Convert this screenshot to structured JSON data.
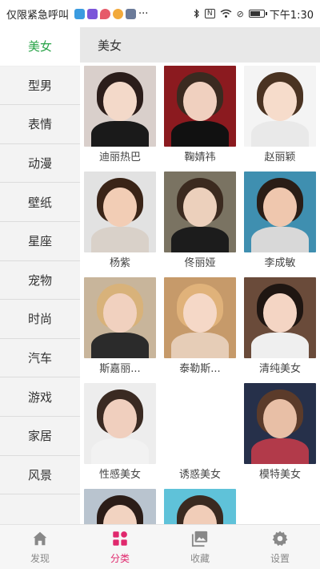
{
  "status_bar": {
    "carrier_text": "仅限紧急呼叫",
    "notification_icons": [
      "person-icon",
      "app-icon",
      "location-icon",
      "coin-icon",
      "image-icon"
    ],
    "more": "···",
    "time": "下午1:30",
    "battery_level": 0.8
  },
  "sidebar": {
    "items": [
      {
        "label": "美女",
        "active": true
      },
      {
        "label": "型男"
      },
      {
        "label": "表情"
      },
      {
        "label": "动漫"
      },
      {
        "label": "壁纸"
      },
      {
        "label": "星座"
      },
      {
        "label": "宠物"
      },
      {
        "label": "时尚"
      },
      {
        "label": "汽车"
      },
      {
        "label": "游戏"
      },
      {
        "label": "家居"
      },
      {
        "label": "风景"
      }
    ]
  },
  "content": {
    "header": "美女",
    "tiles": [
      {
        "label": "迪丽热巴",
        "colors": [
          "#d9cfcb",
          "#2b1d1a",
          "#f3d9c9",
          "#1a1a1a"
        ]
      },
      {
        "label": "鞠婧祎",
        "colors": [
          "#8b1a1f",
          "#3a2a20",
          "#f0d0bf",
          "#111111"
        ]
      },
      {
        "label": "赵丽颖",
        "colors": [
          "#f4f4f4",
          "#4a3322",
          "#f6dccb",
          "#e9e9e9"
        ]
      },
      {
        "label": "杨紫",
        "colors": [
          "#e2e2e2",
          "#3a2417",
          "#f2cdb5",
          "#d9d1c9"
        ]
      },
      {
        "label": "佟丽娅",
        "colors": [
          "#7a7362",
          "#3b2a1f",
          "#ecd0bc",
          "#1c1c1c"
        ]
      },
      {
        "label": "李成敏",
        "colors": [
          "#3f8fb0",
          "#2a1d16",
          "#efc7ae",
          "#d8d8d8"
        ]
      },
      {
        "label": "斯嘉丽...",
        "colors": [
          "#c8b59b",
          "#d8b27a",
          "#f1d1bf",
          "#2b2b2b"
        ]
      },
      {
        "label": "泰勒斯...",
        "colors": [
          "#c69a6a",
          "#e0b27a",
          "#f5d8c7",
          "#e6cdb7"
        ]
      },
      {
        "label": "清纯美女",
        "colors": [
          "#6a4b3a",
          "#1f1612",
          "#f4d5c4",
          "#efefef"
        ]
      },
      {
        "label": "性感美女",
        "colors": [
          "#ededed",
          "#3a2a22",
          "#f0cfbe",
          "#f2f2f2"
        ]
      },
      {
        "label": "诱惑美女",
        "colors": [
          "#ffffff",
          "#ffffff",
          "#ffffff",
          "#ffffff"
        ]
      },
      {
        "label": "模特美女",
        "colors": [
          "#26304a",
          "#5b3b2a",
          "#e8bfa6",
          "#b23a4a"
        ]
      },
      {
        "label": "",
        "colors": [
          "#b9c4cf",
          "#2b1d18",
          "#f2d3c1",
          "#9aa7b5"
        ]
      },
      {
        "label": "",
        "colors": [
          "#5fc2d9",
          "#3a2a20",
          "#f1cdb8",
          "#ffffff"
        ]
      }
    ]
  },
  "bottom_nav": {
    "items": [
      {
        "label": "发现",
        "icon": "home-icon"
      },
      {
        "label": "分类",
        "icon": "grid-icon",
        "active": true
      },
      {
        "label": "收藏",
        "icon": "picture-icon"
      },
      {
        "label": "设置",
        "icon": "gear-icon"
      }
    ],
    "active_color": "#e0286d",
    "inactive_color": "#888888"
  },
  "accent_color": "#2aa449"
}
